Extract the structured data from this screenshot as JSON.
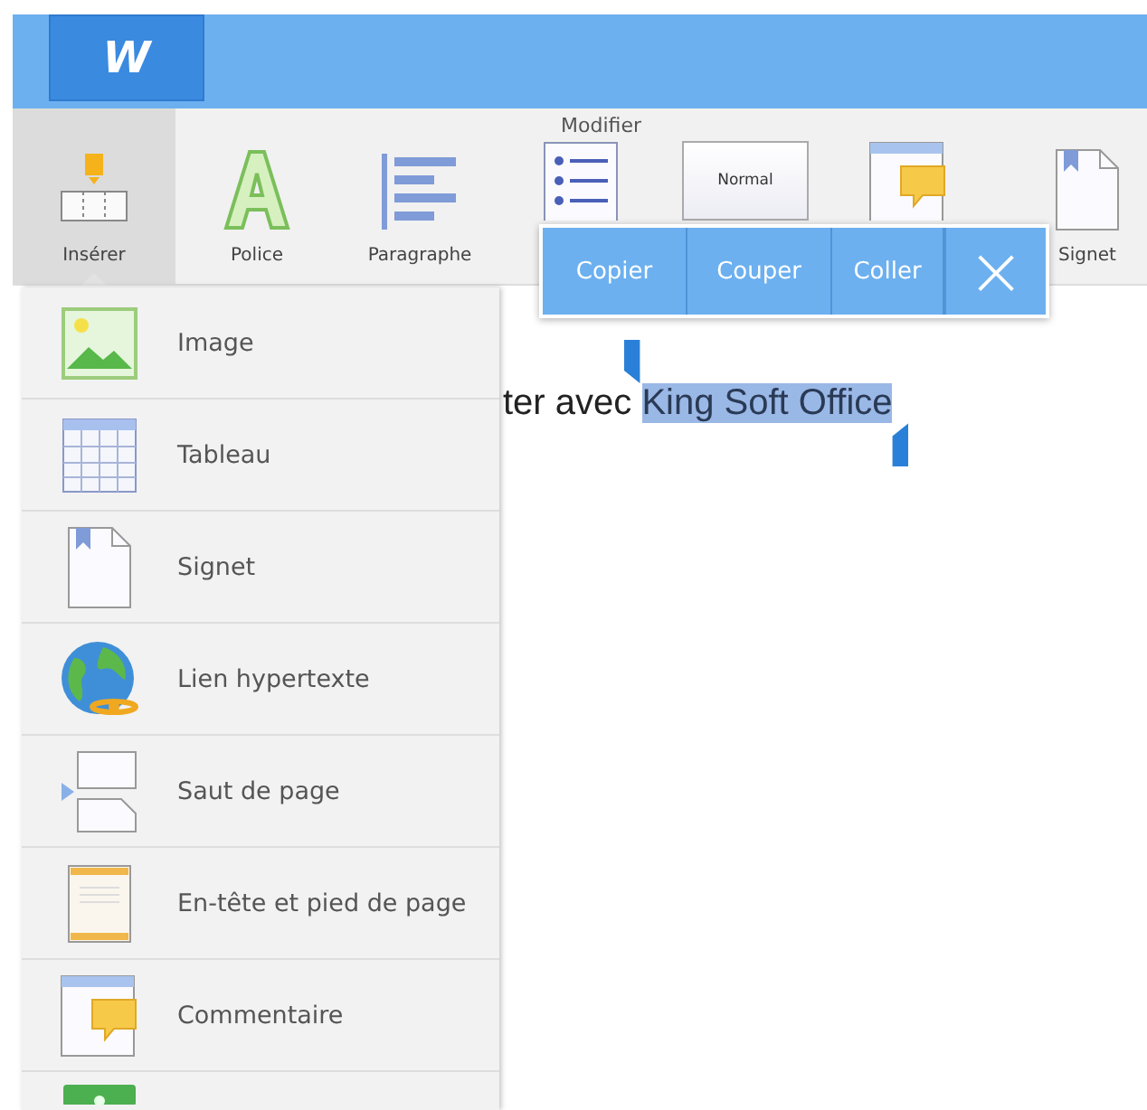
{
  "app_bar": {
    "logo": "W"
  },
  "toolbar": {
    "group_label": "Modifier",
    "items": [
      {
        "kind": "insert",
        "label": "Insérer",
        "selected": true
      },
      {
        "kind": "font",
        "label": "Police",
        "selected": false
      },
      {
        "kind": "paragraph",
        "label": "Paragraphe",
        "selected": false
      },
      {
        "kind": "list",
        "selected": false
      },
      {
        "kind": "style",
        "preview": "Normal",
        "selected": false
      },
      {
        "kind": "comment",
        "selected": false
      },
      {
        "kind": "bookmark",
        "label": "Signet",
        "selected": false
      }
    ]
  },
  "selection_popup": {
    "actions": [
      "Copier",
      "Couper",
      "Coller"
    ],
    "close": "×"
  },
  "document": {
    "text_before": "ter avec ",
    "selected_text": "King Soft Office"
  },
  "insert_menu": [
    {
      "kind": "image",
      "label": "Image"
    },
    {
      "kind": "table",
      "label": "Tableau"
    },
    {
      "kind": "bookmark",
      "label": "Signet"
    },
    {
      "kind": "link",
      "label": "Lien hypertexte"
    },
    {
      "kind": "pagebreak",
      "label": "Saut de page"
    },
    {
      "kind": "headerfooter",
      "label": "En-tête et pied de page"
    },
    {
      "kind": "comment",
      "label": "Commentaire"
    },
    {
      "kind": "more"
    }
  ]
}
